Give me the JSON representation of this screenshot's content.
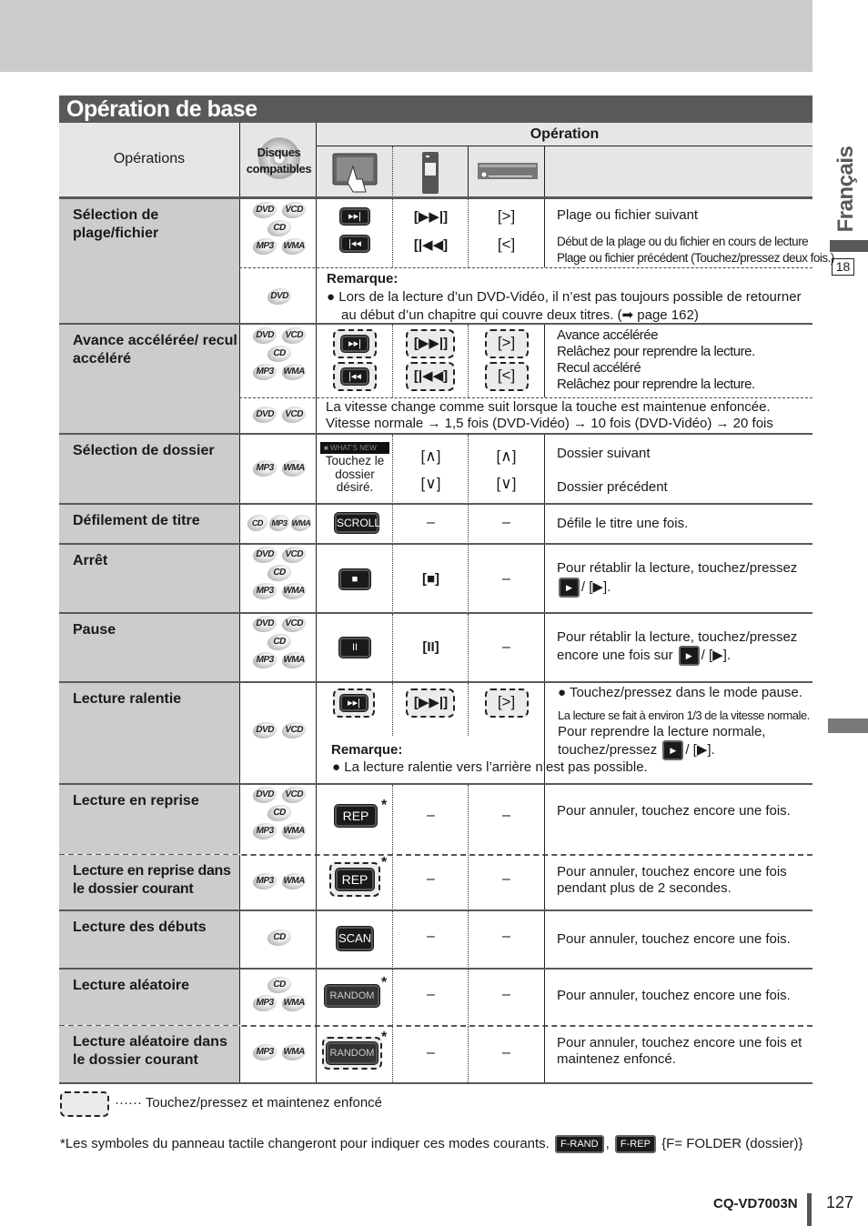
{
  "section_title": "Opération de base",
  "side_tab": {
    "language": "Français",
    "page_ref": "18"
  },
  "header": {
    "operations": "Opérations",
    "discs": "Disques compatibles",
    "operation": "Opération",
    "icons": [
      "touch-panel-icon",
      "remote-control-icon",
      "main-unit-icon"
    ]
  },
  "rows": [
    {
      "name": "Sélection de plage/fichier",
      "discs": [
        [
          "DVD",
          "VCD"
        ],
        [
          "CD"
        ],
        [
          "MP3",
          "WMA"
        ]
      ],
      "touch": [
        "next-track-button",
        "prev-track-button"
      ],
      "remote": [
        "[▶▶|]",
        "[|◀◀]"
      ],
      "unit": [
        "[>]",
        "[<]"
      ],
      "desc": [
        "Plage ou fichier suivant",
        "Début de la plage ou du fichier en cours de lecture",
        "Plage ou fichier précédent (Touchez/pressez deux fois.)"
      ],
      "sub": {
        "discs": [
          [
            "DVD"
          ]
        ],
        "title": "Remarque:",
        "text": "● Lors de la lecture d’un DVD-Vidéo, il n’est pas toujours possible de retourner",
        "text2": "au début d’un chapitre qui couvre deux titres. (➡ page 162)"
      }
    },
    {
      "name": "Avance accélérée/ recul accéléré",
      "discs": [
        [
          "DVD",
          "VCD"
        ],
        [
          "CD"
        ],
        [
          "MP3",
          "WMA"
        ]
      ],
      "remote": [
        "[▶▶|]",
        "[|◀◀]"
      ],
      "unit": [
        "[>]",
        "[<]"
      ],
      "desc": [
        "Avance accélérée",
        "Relâchez pour reprendre la lecture.",
        "Recul accéléré",
        "Relâchez pour reprendre la lecture."
      ],
      "sub": {
        "discs": [
          [
            "DVD",
            "VCD"
          ]
        ],
        "text": "La vitesse change comme suit lorsque la touche est maintenue enfoncée.",
        "text2": "Vitesse normale → 1,5 fois (DVD-Vidéo) → 10 fois (DVD-Vidéo) → 20 fois"
      }
    },
    {
      "name": "Sélection de dossier",
      "discs": [
        [
          "MP3",
          "WMA"
        ]
      ],
      "touch_strip": "■ WHAT'S NEW",
      "touch_text": "Touchez le dossier désiré.",
      "remote": [
        "[∧]",
        "[∨]"
      ],
      "unit": [
        "[∧]",
        "[∨]"
      ],
      "desc": [
        "Dossier suivant",
        "Dossier précédent"
      ]
    },
    {
      "name": "Défilement de titre",
      "discs": [
        [
          "CD",
          "MP3",
          "WMA"
        ]
      ],
      "touch_label": "SCROLL",
      "remote": "–",
      "unit": "–",
      "desc": "Défile le titre une fois."
    },
    {
      "name": "Arrêt",
      "discs": [
        [
          "DVD",
          "VCD"
        ],
        [
          "CD"
        ],
        [
          "MP3",
          "WMA"
        ]
      ],
      "touch_label": "■",
      "remote": "[■]",
      "unit": "–",
      "desc": "Pour rétablir la lecture, touchez/pressez",
      "desc2": "/ [▶]."
    },
    {
      "name": "Pause",
      "discs": [
        [
          "DVD",
          "VCD"
        ],
        [
          "CD"
        ],
        [
          "MP3",
          "WMA"
        ]
      ],
      "touch_label": "II",
      "remote": "[II]",
      "unit": "–",
      "desc": "Pour rétablir la lecture, touchez/pressez",
      "desc2": "encore une fois sur",
      "desc3": "/ [▶]."
    },
    {
      "name": "Lecture ralentie",
      "discs": [
        [
          "DVD",
          "VCD"
        ]
      ],
      "remote": "[▶▶|]",
      "unit": "[>]",
      "desc": "● Touchez/pressez dans le mode pause.",
      "desc_small": "La lecture se fait à environ 1/3 de la vitesse normale.",
      "desc2": "Pour reprendre la lecture normale,",
      "desc3": "touchez/pressez",
      "desc4": "/ [▶].",
      "note_title": "Remarque:",
      "note": "● La lecture ralentie vers l’arrière n’est pas possible."
    },
    {
      "name": "Lecture en reprise",
      "discs": [
        [
          "DVD",
          "VCD"
        ],
        [
          "CD"
        ],
        [
          "MP3",
          "WMA"
        ]
      ],
      "touch_label": "REP",
      "star": "*",
      "remote": "–",
      "unit": "–",
      "desc": "Pour annuler, touchez encore une fois."
    },
    {
      "name": "Lecture en reprise dans le dossier courant",
      "discs": [
        [
          "MP3",
          "WMA"
        ]
      ],
      "touch_label": "REP",
      "star": "*",
      "remote": "–",
      "unit": "–",
      "desc": "Pour annuler, touchez encore une fois pendant plus de 2 secondes."
    },
    {
      "name": "Lecture des débuts",
      "discs": [
        [
          "CD"
        ]
      ],
      "touch_label": "SCAN",
      "remote": "–",
      "unit": "–",
      "desc": "Pour annuler, touchez encore une fois."
    },
    {
      "name": "Lecture aléatoire",
      "discs": [
        [
          "CD"
        ],
        [
          "MP3",
          "WMA"
        ]
      ],
      "touch_label": "RANDOM",
      "star": "*",
      "remote": "–",
      "unit": "–",
      "desc": "Pour annuler, touchez encore une fois."
    },
    {
      "name": "Lecture aléatoire dans le dossier courant",
      "discs": [
        [
          "MP3",
          "WMA"
        ]
      ],
      "touch_label": "RANDOM",
      "star": "*",
      "remote": "–",
      "unit": "–",
      "desc": "Pour annuler, touchez encore une fois et maintenez enfoncé."
    }
  ],
  "legend": "······ Touchez/pressez et maintenez enfoncé",
  "footnote": {
    "text": "*Les symboles du panneau tactile changeront pour indiquer ces modes courants.",
    "btn1": "F-RAND",
    "sep": ",",
    "btn2": "F-REP",
    "tail": "{F= FOLDER (dossier)}"
  },
  "footer": {
    "model": "CQ-VD7003N",
    "page": "127"
  },
  "play_label": "▶"
}
